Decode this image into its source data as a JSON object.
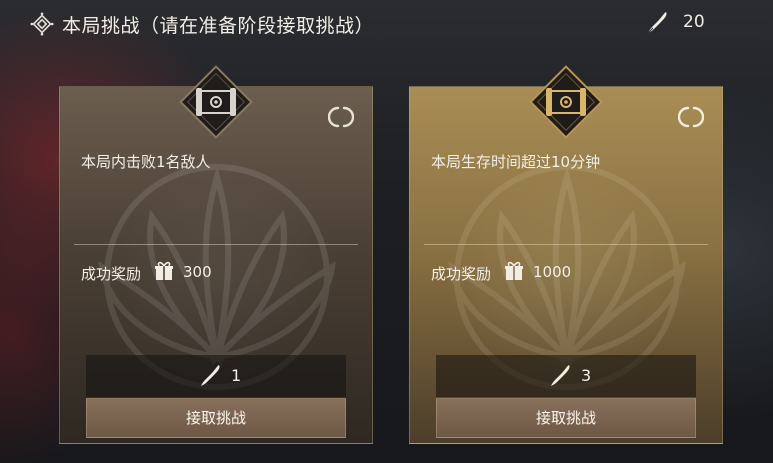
{
  "header": {
    "title": "本局挑战（请在准备阶段接取挑战）",
    "icon": "diamond-emblem-icon",
    "token_icon": "quill-token-icon",
    "token_count": "20"
  },
  "cards": [
    {
      "badge_icon": "scroll-badge-icon",
      "refresh_icon": "refresh-icon",
      "task": "本局内击败1名敌人",
      "reward_label": "成功奖励",
      "reward_icon": "gift-box-icon",
      "reward_value": "300",
      "cost_icon": "quill-token-icon",
      "cost_value": "1",
      "button_label": "接取挑战",
      "theme_color": "#4b4035"
    },
    {
      "badge_icon": "scroll-badge-icon",
      "refresh_icon": "refresh-icon",
      "task": "本局生存时间超过10分钟",
      "reward_label": "成功奖励",
      "reward_icon": "gift-box-icon",
      "reward_value": "1000",
      "cost_icon": "quill-token-icon",
      "cost_value": "3",
      "button_label": "接取挑战",
      "theme_color": "#8a7142"
    }
  ],
  "colors": {
    "button": "#7a6450",
    "badge_gold": "#d9b56a",
    "badge_silver": "#d8d4cc"
  }
}
